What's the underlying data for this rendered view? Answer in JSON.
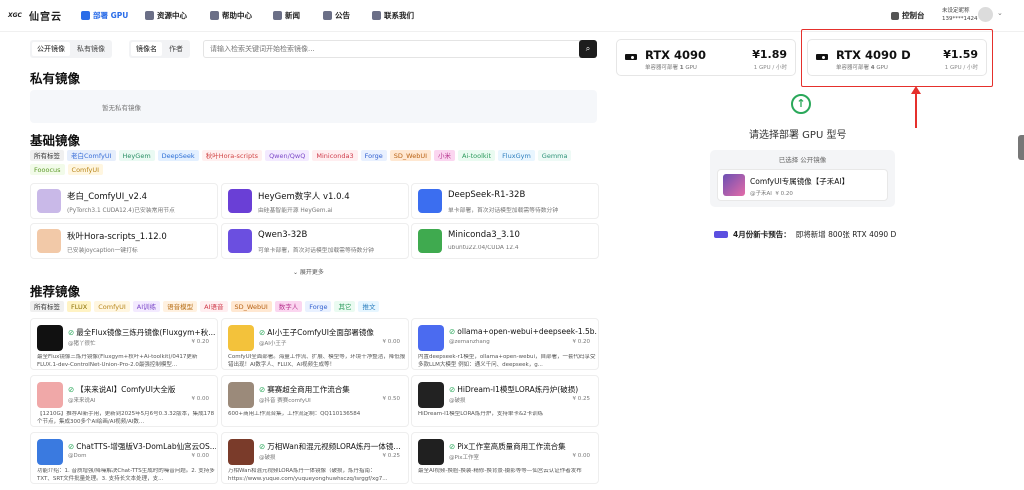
{
  "brand": {
    "logo_mark": "XGC",
    "name": "仙宫云"
  },
  "nav": [
    {
      "label": "部署 GPU",
      "active": true
    },
    {
      "label": "资源中心",
      "active": false
    },
    {
      "label": "帮助中心",
      "active": false
    },
    {
      "label": "新闻",
      "active": false
    },
    {
      "label": "公告",
      "active": false
    },
    {
      "label": "联系我们",
      "active": false
    }
  ],
  "console_label": "控制台",
  "user": {
    "nickname": "未设定昵称",
    "phone": "139****1424",
    "chevron": "⌄"
  },
  "filters": {
    "scope_tabs": [
      "公开镜像",
      "私有镜像"
    ],
    "field_tabs": [
      "镜像名",
      "作者"
    ],
    "search_placeholder": "请输入检索关键词开始检索镜像...",
    "search_icon": "⌕"
  },
  "private": {
    "title": "私有镜像",
    "empty_text": "暂无私有镜像"
  },
  "basic": {
    "title": "基础镜像",
    "tags": [
      {
        "label": "所有标签",
        "bg": "#f0f0f0",
        "fg": "#333"
      },
      {
        "label": "老白ComfyUI",
        "bg": "#e6eefc",
        "fg": "#3a6fd8"
      },
      {
        "label": "HeyGem",
        "bg": "#eafaf3",
        "fg": "#2a8f65"
      },
      {
        "label": "DeepSeek",
        "bg": "#e3f0ff",
        "fg": "#2c6fd6"
      },
      {
        "label": "秋叶Hora-scripts",
        "bg": "#fff0f0",
        "fg": "#d14545"
      },
      {
        "label": "Qwen/QwQ",
        "bg": "#f3eaff",
        "fg": "#7c49c9"
      },
      {
        "label": "Miniconda3",
        "bg": "#ffeef0",
        "fg": "#cf3b4b"
      },
      {
        "label": "Forge",
        "bg": "#e9f1ff",
        "fg": "#2f5ecf"
      },
      {
        "label": "SD_WebUI",
        "bg": "#ffe8d2",
        "fg": "#b86214"
      },
      {
        "label": "小米",
        "bg": "#fbd6f0",
        "fg": "#b8378f"
      },
      {
        "label": "Ai-toolkit",
        "bg": "#eafbf1",
        "fg": "#2c9a5c"
      },
      {
        "label": "FluxGym",
        "bg": "#e9f6ff",
        "fg": "#2d7fbf"
      },
      {
        "label": "Gemma",
        "bg": "#eefaf6",
        "fg": "#2f9479"
      },
      {
        "label": "Fooocus",
        "bg": "#f2fbe9",
        "fg": "#5d9a2a"
      },
      {
        "label": "ComfyUI",
        "bg": "#fff6e0",
        "fg": "#b8861a"
      }
    ],
    "cards": [
      {
        "title": "老白_ComfyUI_v2.4",
        "sub": "(PyTorch3.1 CUDA12.4)已安装常用节点",
        "color": "#c9b9e8"
      },
      {
        "title": "HeyGem数字人 v1.0.4",
        "sub": "由硅基智能开源 HeyGem.ai",
        "color": "#6a3fd6"
      },
      {
        "title": "DeepSeek-R1-32B",
        "sub": "单卡部署，首次对话模型加载需等待数分钟",
        "color": "#3b6ef0"
      },
      {
        "title": "秋叶Hora-scripts_1.12.0",
        "sub": "已安装joycaption一键打标",
        "color": "#f2c9a8"
      },
      {
        "title": "Qwen3-32B",
        "sub": "可单卡部署，首次对话模型加载需等待数分钟",
        "color": "#6b4fe0"
      },
      {
        "title": "Miniconda3_3.10",
        "sub": "ubuntu22.04/CUDA 12.4",
        "color": "#3faa4f"
      }
    ],
    "expand_label": "⌄ 展开更多"
  },
  "recommend": {
    "title": "推荐镜像",
    "tags": [
      {
        "label": "所有标签",
        "bg": "#f0f0f0",
        "fg": "#333"
      },
      {
        "label": "FLUX",
        "bg": "#fff3c4",
        "fg": "#8a6d00"
      },
      {
        "label": "ComfyUI",
        "bg": "#fff6e0",
        "fg": "#b8861a"
      },
      {
        "label": "AI训练",
        "bg": "#f3eaff",
        "fg": "#7c49c9"
      },
      {
        "label": "语音模型",
        "bg": "#fff1e0",
        "fg": "#b8701a"
      },
      {
        "label": "AI语音",
        "bg": "#ffeef0",
        "fg": "#cf3b4b"
      },
      {
        "label": "SD_WebUI",
        "bg": "#ffe8d2",
        "fg": "#b86214"
      },
      {
        "label": "数字人",
        "bg": "#fbd6f0",
        "fg": "#b8378f"
      },
      {
        "label": "Forge",
        "bg": "#e9f1ff",
        "fg": "#2f5ecf"
      },
      {
        "label": "其它",
        "bg": "#eafbf1",
        "fg": "#2c9a5c"
      },
      {
        "label": "推文",
        "bg": "#e6f6ff",
        "fg": "#2d7fbf"
      }
    ],
    "cards": [
      {
        "title": "最全Flux镜像三炼丹镜像(Fluxgym+秋...",
        "author": "@猪丫很忙",
        "price": "¥ 0.20",
        "desc": "最全Flux镜像三炼丹镜像(Fluxgym+秋叶+Ai-toolkit)/0417更新FLUX.1-dev-ControlNet-Union-Pro-2.0最强控制模型...",
        "color": "#111111"
      },
      {
        "title": "AI小王子ComfyUI全面部署镜像",
        "author": "@AI小王子",
        "price": "¥ 0.00",
        "desc": "ComfyUI全面部署。海量工作流、扩展、模型等，环境干净整洁，降低报错出现！AI数字人、FLUX、AI视频生成等！",
        "color": "#f3c23b"
      },
      {
        "title": "ollama+open-webui+deepseek-1.5b...",
        "author": "@zemanzhang",
        "price": "¥ 0.20",
        "desc": "内置deepseek-r1模型，ollama+open-webui，自部署，一套代码享受多款LLM大模型 例如：通义千问、deepseek，g...",
        "color": "#4b6bf0"
      },
      {
        "title": "【来来说AI】ComfyUI大全版",
        "author": "@来来说AI",
        "price": "¥ 0.00",
        "desc": "【1210G】推荐AI新手用，更新到2025年5月6号0.3.32版本，集成178个节点，集成300多个AI绘画/AI视频/AI数...",
        "color": "#f0a8a8"
      },
      {
        "title": "赛赛超全商用工作流合集",
        "author": "@抖音 赛赛comfyUI",
        "price": "¥ 0.50",
        "desc": "600+商用工作流合集，工作流定制：QQ110136584",
        "color": "#9b8a7a"
      },
      {
        "title": "HiDream-I1模型LORA炼丹炉(破损)",
        "author": "@破损",
        "price": "¥ 0.25",
        "desc": "HiDream-I1模型LORA炼丹炉，支持单卡&2卡训练",
        "color": "#222222"
      },
      {
        "title": "ChatTTS-增强版V3-DomLab仙宫云OS...",
        "author": "@Dom",
        "price": "¥ 0.00",
        "desc": "功能介绍：1. 音质增强/降噪解决Chat-TTS生成时的噪音问题。2. 支持多TXT、SRT文件批量处理。3. 支持长文本处理，支...",
        "color": "#3a7ae0"
      },
      {
        "title": "万相Wan和混元视频LORA炼丹一体镜...",
        "author": "@破损",
        "price": "¥ 0.25",
        "desc": "万相Wan和混元视频LORA炼丹一体镜像（破损，炼丹指南：https://www.yuque.com/yuqueyonghuwhsczq/isrggf/xg7...",
        "color": "#7a3b2a"
      },
      {
        "title": "Pix工作室高质量商用工作流合集",
        "author": "@Pix工作室",
        "price": "¥ 0.00",
        "desc": "最全AI视频-换脸-换装-精修-换背景-摄影等等—仙宫云认证作者发布",
        "color": "#202020"
      }
    ]
  },
  "gpus": [
    {
      "name": "RTX 4090",
      "desc_prefix": "单容器可部署 ",
      "count": "1",
      "desc_suffix": " GPU",
      "price": "¥1.89",
      "unit": "1 GPU / 小时"
    },
    {
      "name": "RTX 4090 D",
      "desc_prefix": "单容器可部署 ",
      "count": "4",
      "desc_suffix": " GPU",
      "price": "¥1.59",
      "unit": "1 GPU / 小时"
    }
  ],
  "pick_prompt": "请选择部署 GPU 型号",
  "selected": {
    "label": "已选择 公开镜像",
    "title": "ComfyUI专属镜像【子禾AI】",
    "author": "@子禾AI",
    "price": "¥ 0.20"
  },
  "news": {
    "prefix": "4月份新卡预告：",
    "text": "即将新增 800张 RTX 4090 D"
  },
  "icons": {
    "up_arrow": "↑",
    "check": "⊘"
  },
  "colors": {
    "accent": "#2b6de8",
    "highlight": "#e5302c",
    "success": "#2aa85a"
  }
}
